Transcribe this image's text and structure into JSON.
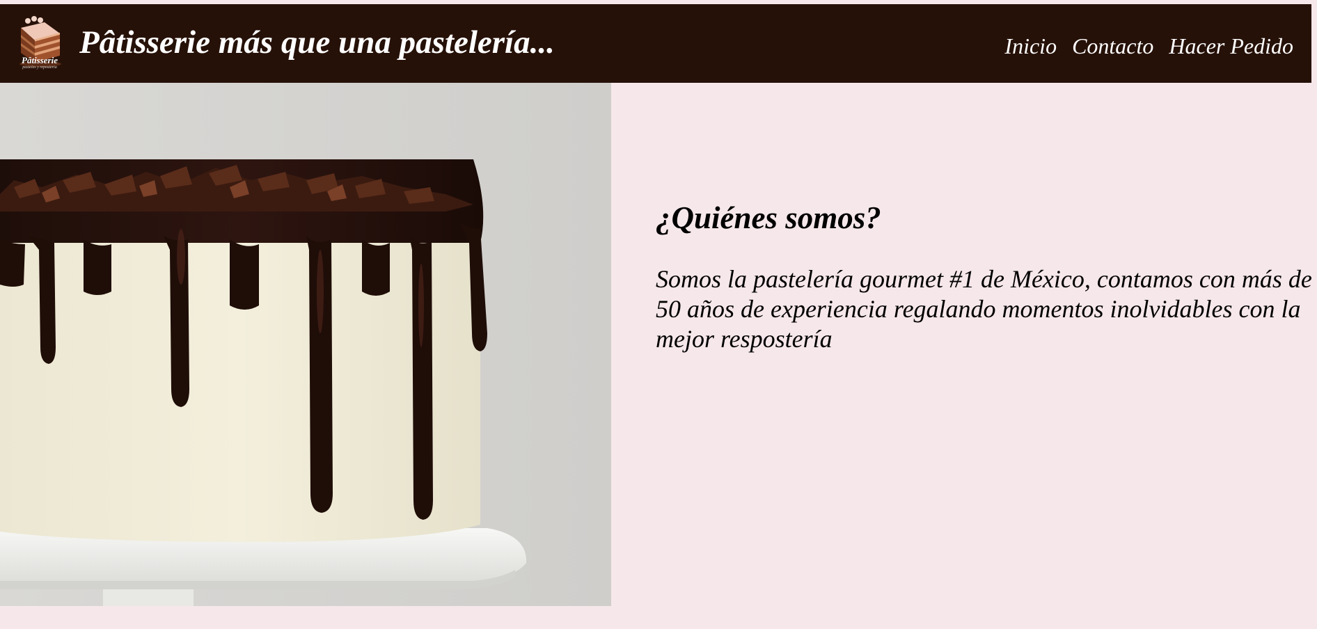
{
  "header": {
    "logo_text": "Pâtisserie",
    "logo_subtext": "pasteles y reposteria",
    "title": "Pâtisserie más que una pastelería...",
    "nav": [
      {
        "label": "Inicio"
      },
      {
        "label": "Contacto"
      },
      {
        "label": "Hacer Pedido"
      }
    ]
  },
  "hero": {
    "image": "chocolate-drip-cake-photo"
  },
  "about": {
    "heading": "¿Quiénes somos?",
    "body": "Somos la pastelería gourmet #1 de México, contamos con más de 50 años de experiencia regalando momentos inolvidables con la mejor respostería"
  },
  "colors": {
    "header_bg": "#261108",
    "page_bg": "#f6e7ea",
    "text": "#000000",
    "header_text": "#ffffff"
  }
}
